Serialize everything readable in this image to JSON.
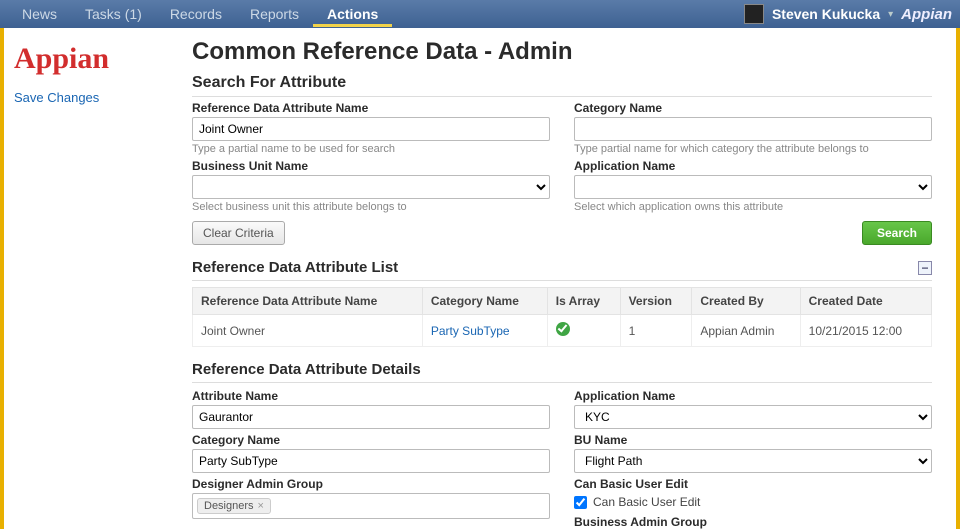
{
  "topnav": {
    "items": [
      "News",
      "Tasks (1)",
      "Records",
      "Reports",
      "Actions"
    ],
    "active_index": 4,
    "user": "Steven Kukucka",
    "brand": "Appian"
  },
  "sidebar": {
    "logo_text": "Appian",
    "save_link": "Save Changes"
  },
  "page": {
    "title": "Common Reference Data - Admin",
    "search_section_title": "Search For Attribute",
    "list_section_title": "Reference Data Attribute List",
    "details_section_title": "Reference Data Attribute Details"
  },
  "search": {
    "attr_name_label": "Reference Data Attribute Name",
    "attr_name_value": "Joint Owner",
    "attr_name_help": "Type a partial name to be used for search",
    "category_label": "Category Name",
    "category_value": "",
    "category_help": "Type partial name for which category the attribute belongs to",
    "bu_label": "Business Unit Name",
    "bu_value": "",
    "bu_help": "Select business unit this attribute belongs to",
    "app_label": "Application Name",
    "app_value": "",
    "app_help": "Select which application owns this attribute",
    "clear_btn": "Clear Criteria",
    "search_btn": "Search"
  },
  "table": {
    "headers": [
      "Reference Data Attribute Name",
      "Category Name",
      "Is Array",
      "Version",
      "Created By",
      "Created Date"
    ],
    "row": {
      "name": "Joint Owner",
      "category": "Party SubType",
      "version": "1",
      "created_by": "Appian Admin",
      "created_date": "10/21/2015 12:00"
    }
  },
  "details": {
    "attr_name_label": "Attribute Name",
    "attr_name_value": "Gaurantor",
    "app_name_label": "Application Name",
    "app_name_value": "KYC",
    "category_label": "Category Name",
    "category_value": "Party SubType",
    "bu_label": "BU Name",
    "bu_value": "Flight Path",
    "designer_label": "Designer Admin Group",
    "designer_token": "Designers",
    "basic_edit_label": "Can Basic User Edit",
    "basic_edit_checkbox_label": "Can Basic User Edit",
    "cutoff_label": "Business Admin Group"
  }
}
